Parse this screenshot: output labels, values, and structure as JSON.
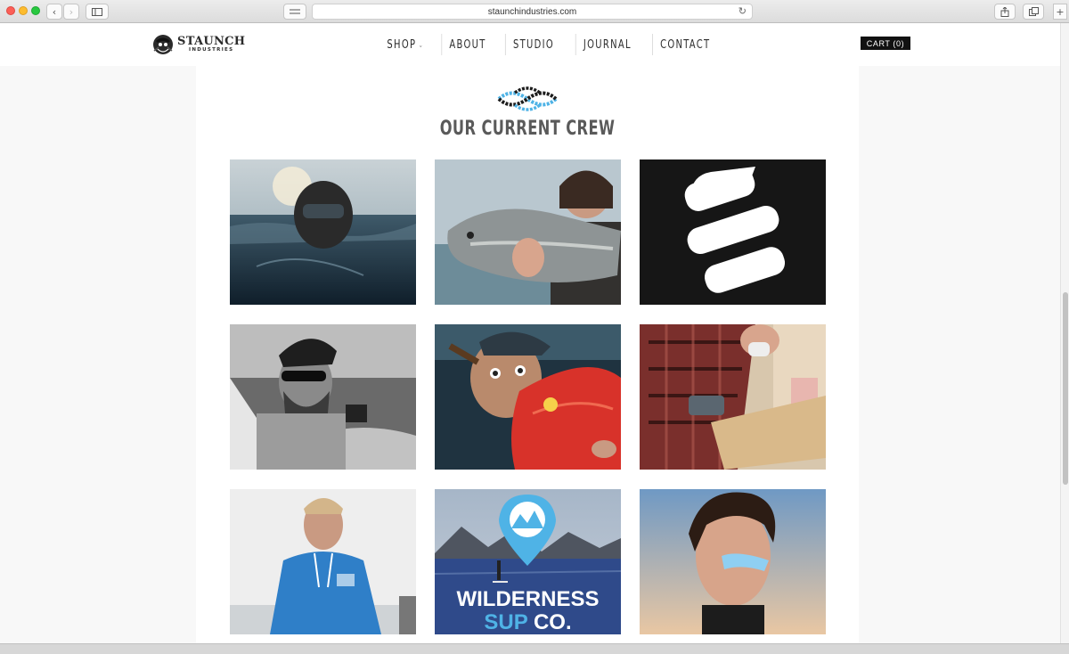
{
  "browser": {
    "url": "staunchindustries.com",
    "back_icon": "chevron-left-icon",
    "forward_icon": "chevron-right-icon",
    "sidebar_icon": "sidebar-icon",
    "share_icon": "share-icon",
    "tabs_icon": "tabs-icon",
    "reload_icon": "reload-icon"
  },
  "header": {
    "logo_title": "STAUNCH",
    "logo_subtitle": "INDUSTRIES",
    "nav": [
      {
        "label": "SHOP",
        "has_dropdown": true
      },
      {
        "label": "ABOUT"
      },
      {
        "label": "STUDIO"
      },
      {
        "label": "JOURNAL"
      },
      {
        "label": "CONTACT"
      }
    ],
    "cart_label": "CART (0)"
  },
  "section": {
    "icon": "rope-knot-icon",
    "title": "OUR CURRENT CREW"
  },
  "crew_tiles": [
    {
      "subject": "diver-in-ocean-photo"
    },
    {
      "subject": "woman-holding-fish-photo"
    },
    {
      "subject": "staunch-s-logo-tile"
    },
    {
      "subject": "bearded-man-sunglasses-bw-photo"
    },
    {
      "subject": "man-cigar-red-fish-photo"
    },
    {
      "subject": "woodworker-planing-photo"
    },
    {
      "subject": "man-blue-hoodie-photo"
    },
    {
      "subject": "wilderness-sup-co-tile",
      "text_line1": "WILDERNESS",
      "text_line2a": "SUP",
      "text_line2b": " CO."
    },
    {
      "subject": "man-face-paint-photo"
    }
  ],
  "colors": {
    "accent_blue": "#4fb3e6",
    "cart_bg": "#111111",
    "title_gray": "#5a5a5a"
  }
}
